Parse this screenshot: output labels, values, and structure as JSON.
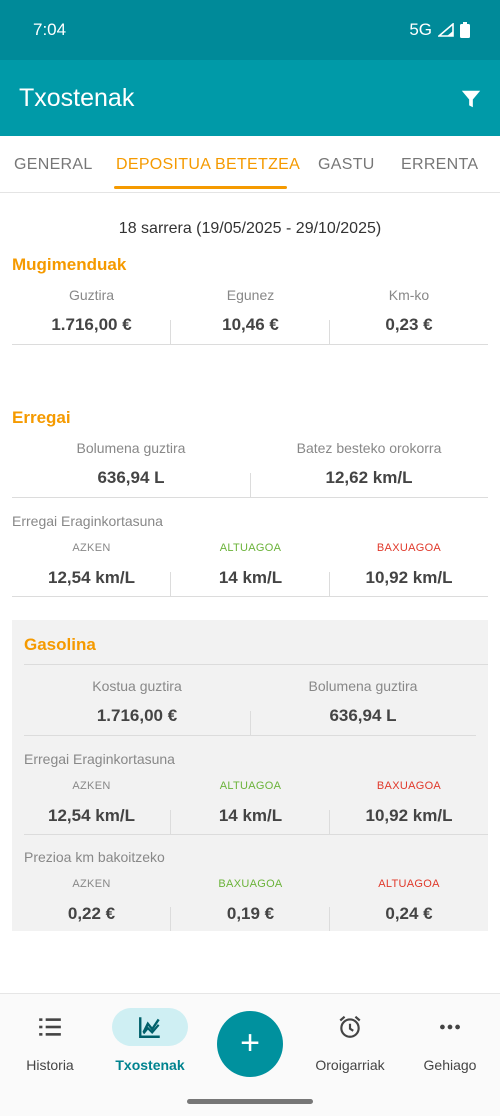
{
  "status": {
    "time": "7:04",
    "network": "5G"
  },
  "appbar": {
    "title": "Txostenak",
    "filter_icon": "filter-icon"
  },
  "tabs": [
    {
      "label": "GENERAL",
      "active": false
    },
    {
      "label": "DEPOSITUA BETETZEA",
      "active": true
    },
    {
      "label": "GASTU",
      "active": false
    },
    {
      "label": "ERRENTA",
      "active": false
    }
  ],
  "range": "18 sarrera (19/05/2025 - 29/10/2025)",
  "mugimenduak": {
    "title": "Mugimenduak",
    "items": [
      {
        "label": "Guztira",
        "value": "1.716,00 €"
      },
      {
        "label": "Egunez",
        "value": "10,46 €"
      },
      {
        "label": "Km-ko",
        "value": "0,23 €"
      }
    ]
  },
  "erregai": {
    "title": "Erregai",
    "items": [
      {
        "label": "Bolumena guztira",
        "value": "636,94 L"
      },
      {
        "label": "Batez besteko orokorra",
        "value": "12,62 km/L"
      }
    ],
    "efficiency_title": "Erregai Eraginkortasuna",
    "efficiency": [
      {
        "tag": "AZKEN",
        "value": "12,54 km/L"
      },
      {
        "tag": "ALTUAGOA",
        "value": "14 km/L"
      },
      {
        "tag": "BAXUAGOA",
        "value": "10,92 km/L"
      }
    ]
  },
  "gasolina": {
    "title": "Gasolina",
    "items": [
      {
        "label": "Kostua guztira",
        "value": "1.716,00 €"
      },
      {
        "label": "Bolumena guztira",
        "value": "636,94 L"
      }
    ],
    "efficiency_title": "Erregai Eraginkortasuna",
    "efficiency": [
      {
        "tag": "AZKEN",
        "value": "12,54 km/L"
      },
      {
        "tag": "ALTUAGOA",
        "value": "14 km/L"
      },
      {
        "tag": "BAXUAGOA",
        "value": "10,92 km/L"
      }
    ],
    "price_title": "Prezioa km bakoitzeko",
    "price": [
      {
        "tag": "AZKEN",
        "value": "0,22 €"
      },
      {
        "tag": "BAXUAGOA",
        "value": "0,19 €"
      },
      {
        "tag": "ALTUAGOA",
        "value": "0,24 €"
      }
    ]
  },
  "colors": {
    "accent": "#f59a00",
    "primary": "#009aa8",
    "green": "#6bb33a",
    "red": "#e0392b"
  },
  "nav": [
    {
      "label": "Historia",
      "icon": "list-icon",
      "active": false
    },
    {
      "label": "Txostenak",
      "icon": "chart-icon",
      "active": true
    },
    {
      "label": "+",
      "icon": "add-icon",
      "active": false
    },
    {
      "label": "Oroigarriak",
      "icon": "alarm-icon",
      "active": false
    },
    {
      "label": "Gehiago",
      "icon": "more-icon",
      "active": false
    }
  ]
}
